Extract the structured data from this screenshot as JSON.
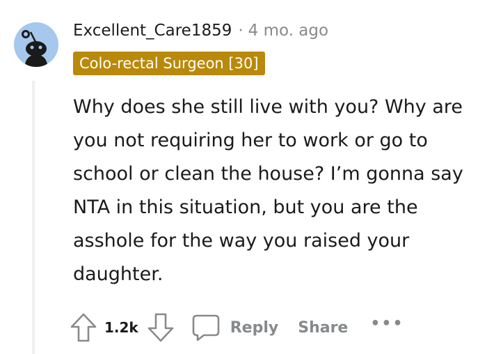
{
  "comment": {
    "author": "Excellent_Care1859",
    "separator": "·",
    "timestamp": "4 mo. ago",
    "flair": "Colo-rectal Surgeon [30]",
    "body": "Why does she still live with you? Why are you not requiring her to work or go to school or clean the house? I’m gonna say NTA in this situation, but you are the asshole for the way you raised your daughter."
  },
  "actions": {
    "vote_count": "1.2k",
    "reply_label": "Reply",
    "share_label": "Share",
    "more_label": "•••"
  },
  "icons": {
    "avatar": "reddit-snoo-avatar-icon",
    "upvote": "arrow-up-icon",
    "downvote": "arrow-down-icon",
    "reply": "speech-bubble-icon",
    "more": "more-options-icon"
  },
  "colors": {
    "flair_background": "#b8890b",
    "flair_text": "#ffffff",
    "avatar_background": "#a5c8ec",
    "muted_text": "#878a8c",
    "thread_line": "#edeff1"
  }
}
